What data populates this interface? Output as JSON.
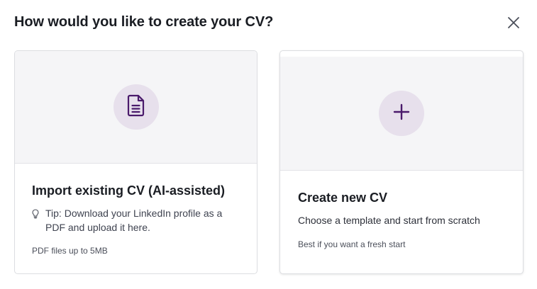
{
  "dialog": {
    "title": "How would you like to create your CV?",
    "close_icon": "close-icon"
  },
  "options": {
    "import": {
      "icon": "document-icon",
      "heading": "Import existing CV (AI-assisted)",
      "tip_icon": "lightbulb-icon",
      "tip": "Tip: Download your LinkedIn profile as a PDF and upload it here.",
      "note": "PDF files up to 5MB"
    },
    "create": {
      "icon": "plus-icon",
      "heading": "Create new CV",
      "description": "Choose a template and start from scratch",
      "note": "Best if you want a fresh start"
    }
  },
  "colors": {
    "accent": "#4a1a6b",
    "icon_circle": "#e7e0ec",
    "media_background": "#f5f5f7",
    "card_border": "#dcdde1"
  }
}
